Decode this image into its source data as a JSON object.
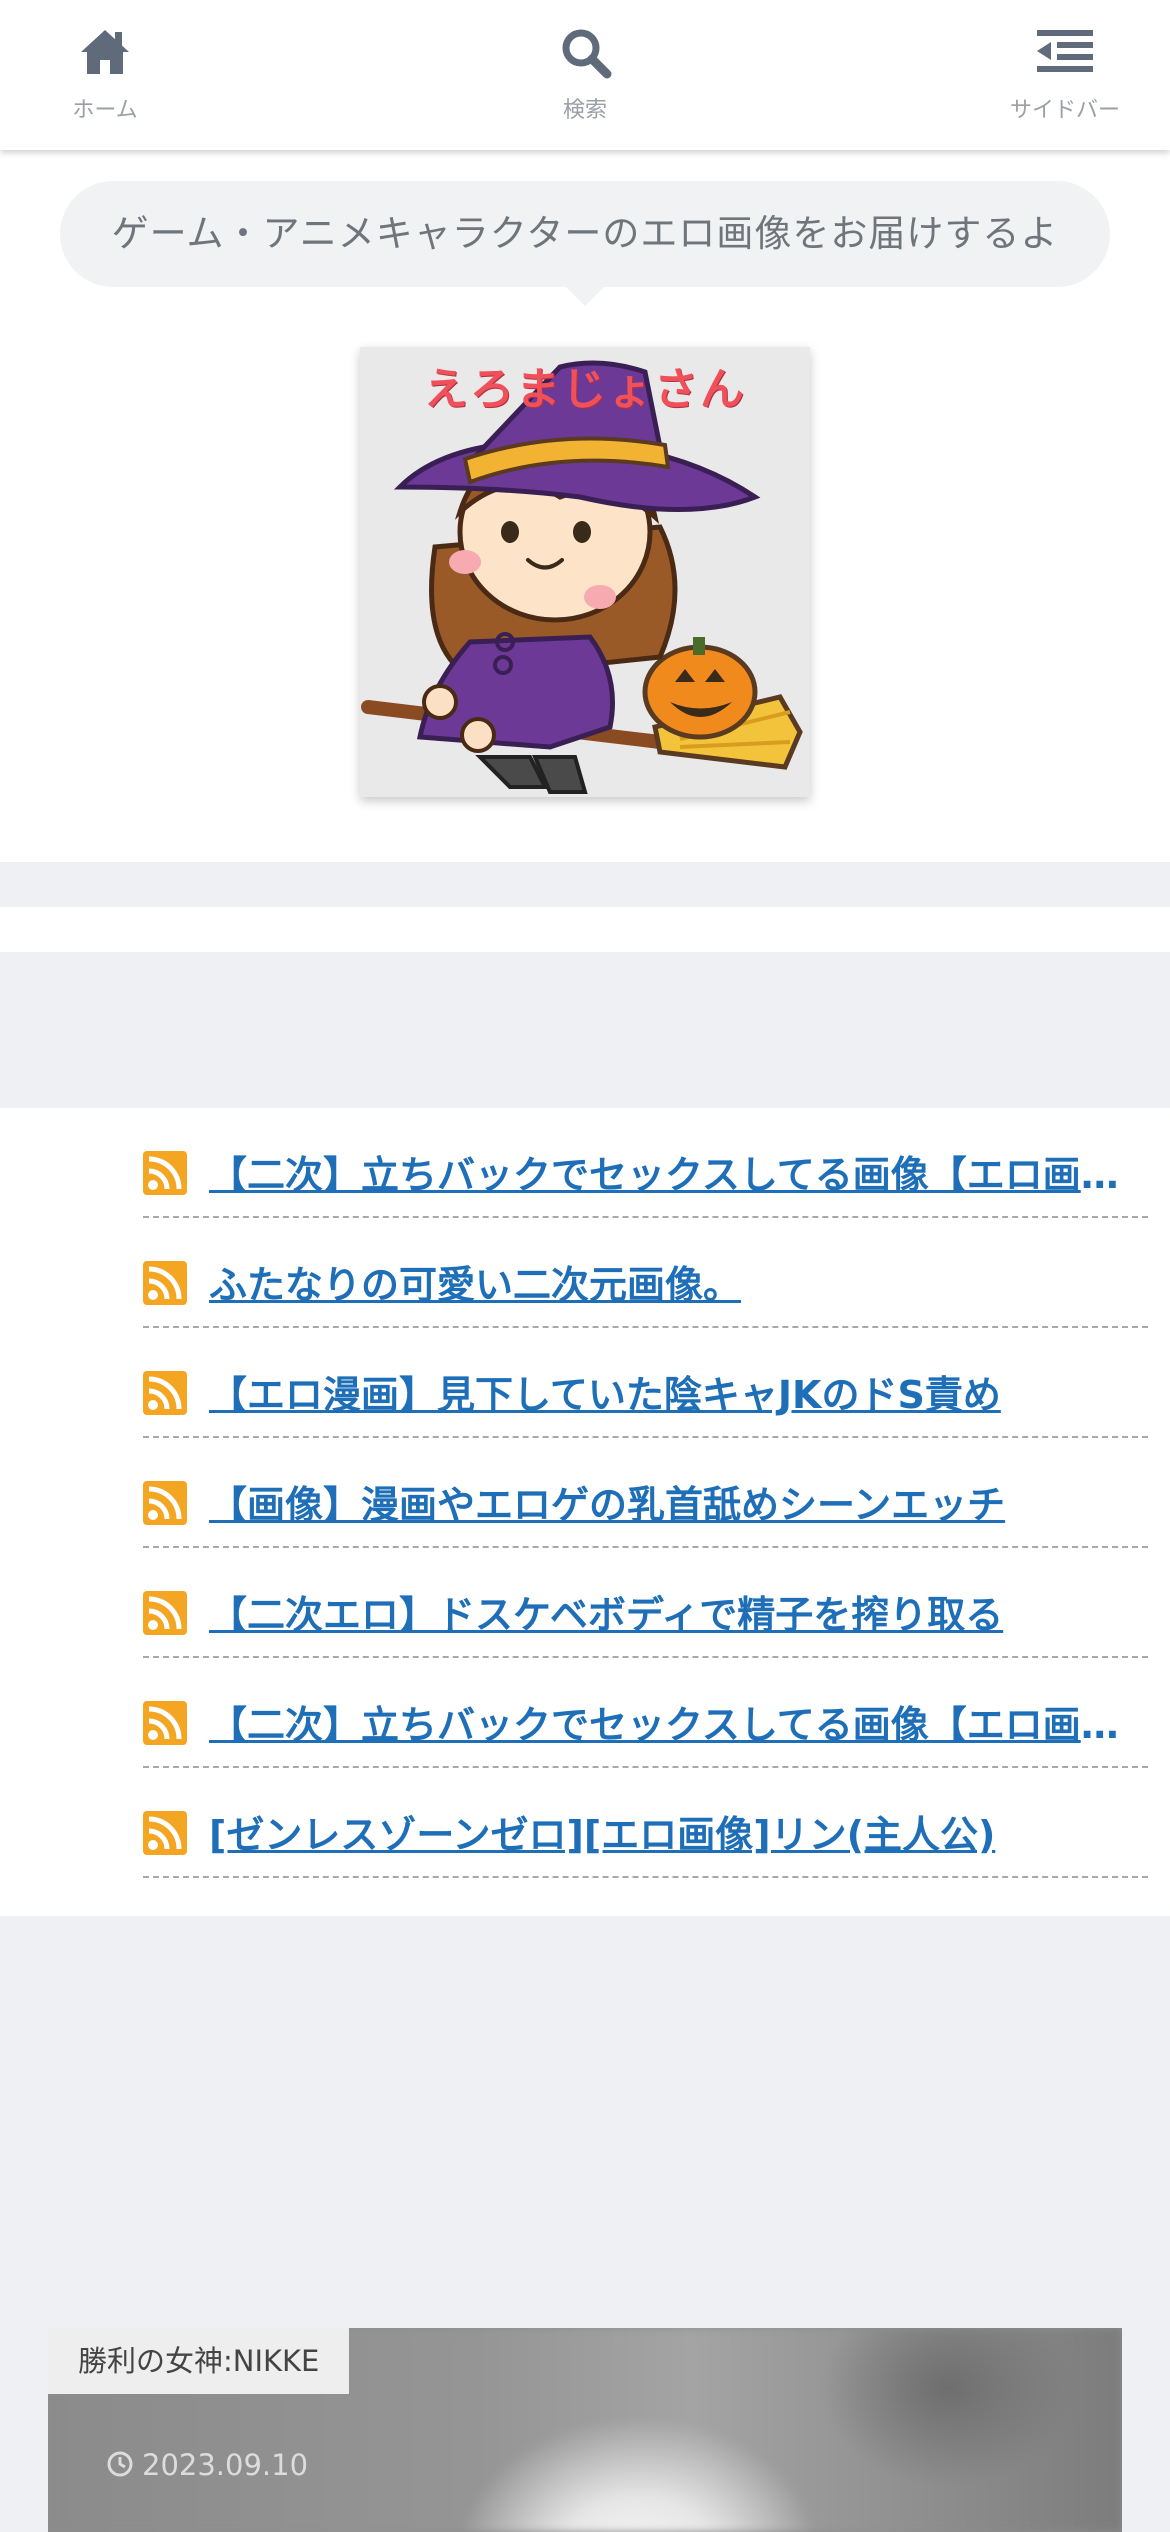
{
  "nav": {
    "home_label": "ホーム",
    "search_label": "検索",
    "sidebar_label": "サイドバー",
    "icon_color": "#5f6b7a"
  },
  "header": {
    "tagline": "ゲーム・アニメキャラクターのエロ画像をお届けするよ",
    "logo_text": "えろまじょさん"
  },
  "rss_items": [
    {
      "title": "【二次】立ちバックでセックスしてる画像【エロ画像】"
    },
    {
      "title": "ふたなりの可愛い二次元画像。"
    },
    {
      "title": "【エロ漫画】見下していた陰キャJKのドS責め"
    },
    {
      "title": "【画像】漫画やエロゲの乳首舐めシーンエッチ"
    },
    {
      "title": "【二次エロ】ドスケベボディで精子を搾り取る"
    },
    {
      "title": "【二次】立ちバックでセックスしてる画像【エロ画像】"
    },
    {
      "title": "[ゼンレスゾーンゼロ][エロ画像]リン(主人公)"
    }
  ],
  "card": {
    "category": "勝利の女神:NIKKE",
    "date": "2023.09.10"
  },
  "colors": {
    "link": "#1e6fb8",
    "rss_orange": "#f4a622",
    "page_bg": "#eef0f3"
  }
}
